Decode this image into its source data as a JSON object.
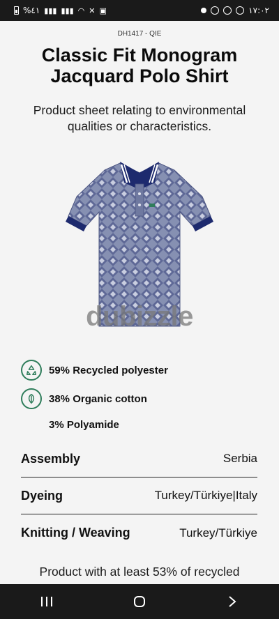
{
  "status_bar": {
    "left_text": "%٤١",
    "time": "١٧:٠٢"
  },
  "product": {
    "code": "DH1417 - QIE",
    "title": "Classic Fit Monogram Jacquard Polo Shirt",
    "subtitle": "Product sheet relating to environmental qualities or characteristics.",
    "image_alt": "polo-shirt"
  },
  "watermark": "dubizzle",
  "materials": [
    {
      "label": "59% Recycled polyester",
      "icon": "recycle-icon"
    },
    {
      "label": "38% Organic cotton",
      "icon": "leaf-icon"
    },
    {
      "label": "3% Polyamide",
      "icon": ""
    }
  ],
  "origin_table": [
    {
      "label": "Assembly",
      "value": "Serbia"
    },
    {
      "label": "Dyeing",
      "value": "Turkey/Türkiye|Italy"
    },
    {
      "label": "Knitting / Weaving",
      "value": "Turkey/Türkiye"
    }
  ],
  "footnote": "Product with at least 53% of recycled",
  "colors": {
    "accent_green": "#2f7d5b",
    "shirt_navy": "#1d2a6e",
    "shirt_grey": "#7d87a8"
  }
}
